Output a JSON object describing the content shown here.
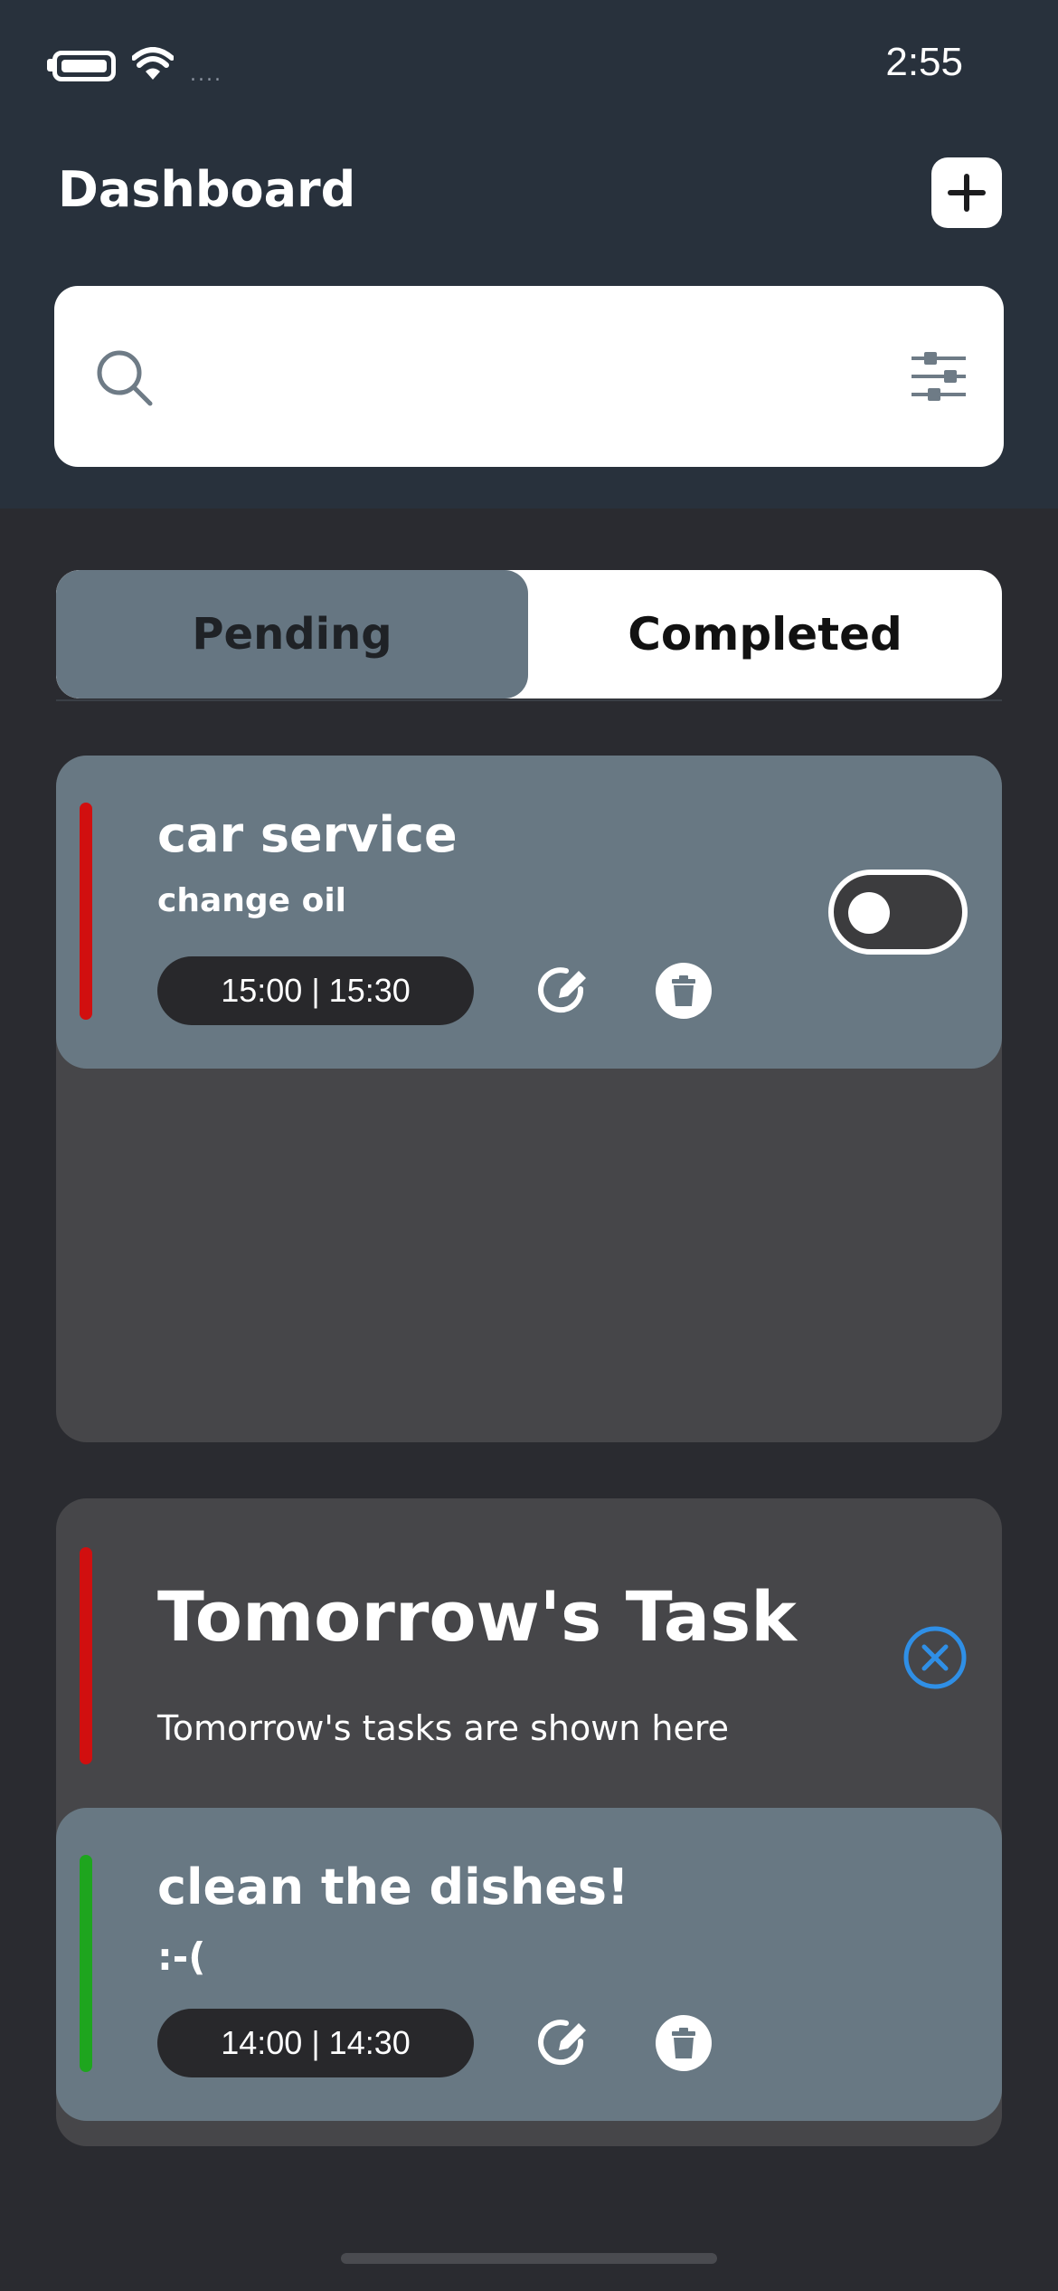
{
  "status_bar": {
    "time": "2:55",
    "signal": "...."
  },
  "header": {
    "title": "Dashboard",
    "add_icon": "plus-icon"
  },
  "search": {
    "placeholder": "",
    "search_icon": "search-icon",
    "filter_icon": "sliders-icon"
  },
  "tabs": [
    {
      "label": "Pending",
      "selected": true
    },
    {
      "label": "Completed",
      "selected": false
    }
  ],
  "tasks_today": [
    {
      "title": "car service",
      "note": "change oil",
      "time": "15:00 |  15:30",
      "color": "#d10f0f",
      "toggle_on": false
    }
  ],
  "tomorrow": {
    "title": "Tomorrow's Task",
    "subtitle": "Tomorrow's tasks are shown here",
    "color": "#d10f0f",
    "tasks": [
      {
        "title": "clean the dishes!",
        "note": ":-(",
        "time": "14:00 |  14:30",
        "color": "#1ea51e"
      }
    ]
  },
  "colors": {
    "accent_blue": "#2f8fe6",
    "card": "#687883",
    "header": "#28313c"
  }
}
